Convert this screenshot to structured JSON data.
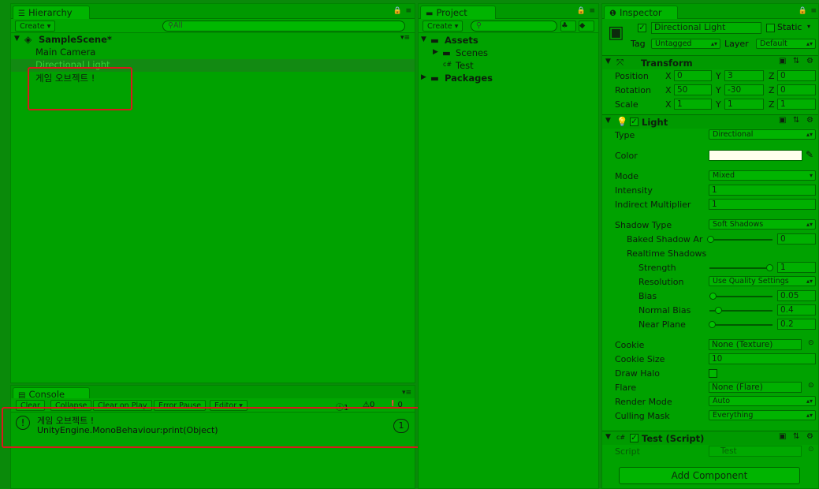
{
  "hierarchy": {
    "tab_label": "Hierarchy",
    "create_label": "Create ▾",
    "search_placeholder": "All",
    "scene_name": "SampleScene*",
    "items": [
      "Main Camera",
      "Directional Light",
      "게임 오브젝트 !"
    ]
  },
  "console": {
    "tab_label": "Console",
    "buttons": [
      "Clear",
      "Collapse",
      "Clear on Play",
      "Error Pause",
      "Editor ▾"
    ],
    "info_count": "1",
    "warn_count": "0",
    "error_count": "0",
    "message_line1": "게임 오브젝트 !",
    "message_line2": "UnityEngine.MonoBehaviour:print(Object)",
    "message_count": "1"
  },
  "project": {
    "tab_label": "Project",
    "create_label": "Create ▾",
    "tree": {
      "assets": "Assets",
      "scenes": "Scenes",
      "test": "Test",
      "packages": "Packages"
    }
  },
  "inspector": {
    "tab_label": "Inspector",
    "object_name": "Directional Light",
    "static_label": "Static",
    "tag_label": "Tag",
    "tag_value": "Untagged",
    "layer_label": "Layer",
    "layer_value": "Default",
    "transform": {
      "title": "Transform",
      "position_label": "Position",
      "rotation_label": "Rotation",
      "scale_label": "Scale",
      "position": {
        "x": "0",
        "y": "3",
        "z": "0"
      },
      "rotation": {
        "x": "50",
        "y": "-30",
        "z": "0"
      },
      "scale": {
        "x": "1",
        "y": "1",
        "z": "1"
      }
    },
    "light": {
      "title": "Light",
      "type_label": "Type",
      "type_value": "Directional",
      "color_label": "Color",
      "color_value": "#ffffee",
      "mode_label": "Mode",
      "mode_value": "Mixed",
      "intensity_label": "Intensity",
      "intensity_value": "1",
      "indirect_label": "Indirect Multiplier",
      "indirect_value": "1",
      "shadow_type_label": "Shadow Type",
      "shadow_type_value": "Soft Shadows",
      "baked_label": "Baked Shadow Ar",
      "baked_value": "0",
      "realtime_label": "Realtime Shadows",
      "strength_label": "Strength",
      "strength_value": "1",
      "resolution_label": "Resolution",
      "resolution_value": "Use Quality Settings",
      "bias_label": "Bias",
      "bias_value": "0.05",
      "normal_bias_label": "Normal Bias",
      "normal_bias_value": "0.4",
      "near_plane_label": "Near Plane",
      "near_plane_value": "0.2",
      "cookie_label": "Cookie",
      "cookie_value": "None (Texture)",
      "cookie_size_label": "Cookie Size",
      "cookie_size_value": "10",
      "draw_halo_label": "Draw Halo",
      "flare_label": "Flare",
      "flare_value": "None (Flare)",
      "render_mode_label": "Render Mode",
      "render_mode_value": "Auto",
      "culling_label": "Culling Mask",
      "culling_value": "Everything"
    },
    "script": {
      "title": "Test (Script)",
      "script_label": "Script",
      "script_value": "Test"
    },
    "add_component_label": "Add Component"
  },
  "colors": {
    "background": "#00a200",
    "annotation_red": "#d8191b",
    "selection": "#128a12"
  }
}
